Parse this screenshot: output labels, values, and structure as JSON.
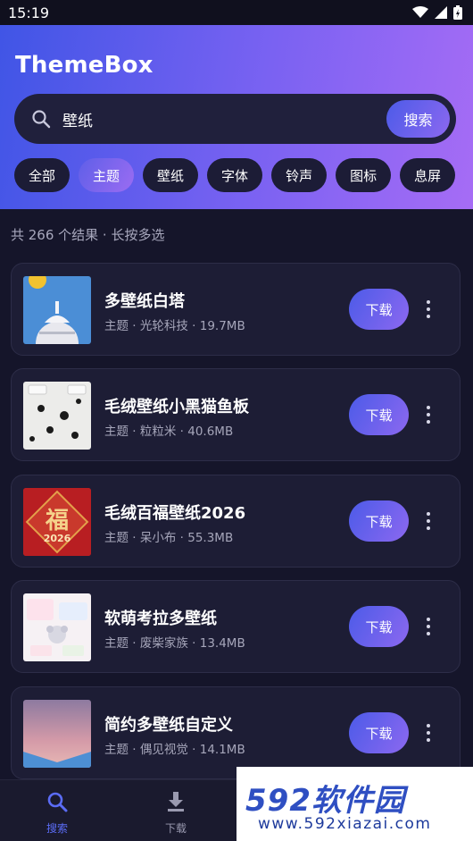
{
  "status_bar": {
    "time": "15:19",
    "icons": [
      "wifi-icon",
      "signal-icon",
      "battery-icon"
    ]
  },
  "header": {
    "title": "ThemeBox"
  },
  "search": {
    "value": "壁纸",
    "button_label": "搜索"
  },
  "chips": [
    {
      "label": "全部",
      "active": false
    },
    {
      "label": "主题",
      "active": true
    },
    {
      "label": "壁纸",
      "active": false
    },
    {
      "label": "字体",
      "active": false
    },
    {
      "label": "铃声",
      "active": false
    },
    {
      "label": "图标",
      "active": false
    },
    {
      "label": "息屏",
      "active": false
    }
  ],
  "results": {
    "summary": "共 266 个结果 · 长按多选"
  },
  "items": [
    {
      "title": "多壁纸白塔",
      "meta": "主题 · 光轮科技 · 19.7MB",
      "download_label": "下载"
    },
    {
      "title": "毛绒壁纸小黑猫鱼板",
      "meta": "主题 · 粒粒米 · 40.6MB",
      "download_label": "下载"
    },
    {
      "title": "毛绒百福壁纸2026",
      "meta": "主题 · 呆小布 · 55.3MB",
      "download_label": "下载",
      "thumb_text": {
        "char": "福",
        "year": "2026"
      }
    },
    {
      "title": "软萌考拉多壁纸",
      "meta": "主题 · 废柴家族 · 13.4MB",
      "download_label": "下载"
    },
    {
      "title": "简约多壁纸自定义",
      "meta": "主题 · 偶见视觉 · 14.1MB",
      "download_label": "下载"
    }
  ],
  "bottom_nav": [
    {
      "label": "搜索",
      "icon": "search-icon",
      "active": true
    },
    {
      "label": "下载",
      "icon": "download-icon",
      "active": false
    }
  ],
  "watermark": {
    "logo": "592软件园",
    "url": "www.592xiazai.com"
  },
  "colors": {
    "accent": "#5b5cf0",
    "active_nav": "#5b6cf5",
    "card_bg": "#1d1d35",
    "page_bg": "#15152a"
  }
}
